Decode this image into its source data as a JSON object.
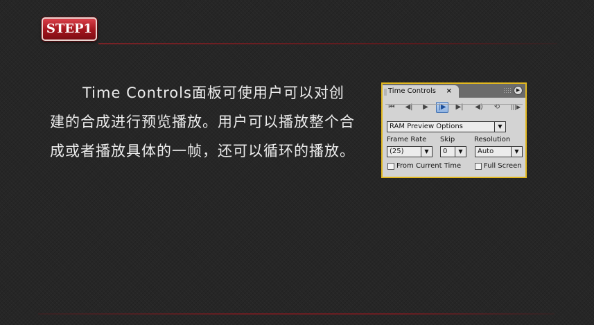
{
  "step_badge": "STEP1",
  "description": "Time Controls面板可使用户可以对创建的合成进行预览播放。用户可以播放整个合成或者播放具体的一帧，还可以循环的播放。",
  "panel": {
    "tab_title": "Time Controls",
    "close_glyph": "×",
    "menu_glyph": "▶",
    "transport": [
      {
        "name": "first-frame",
        "glyph": "⏮"
      },
      {
        "name": "previous-frame",
        "glyph": "◀|"
      },
      {
        "name": "play-pause",
        "glyph": "▶"
      },
      {
        "name": "ram-preview",
        "glyph": "|▶"
      },
      {
        "name": "last-frame",
        "glyph": "▶|"
      },
      {
        "name": "mute-audio",
        "glyph": "◀)"
      },
      {
        "name": "loop",
        "glyph": "⟲"
      },
      {
        "name": "ram-preview-alt",
        "glyph": "|||▶"
      }
    ],
    "preview_options": "RAM Preview Options",
    "frame_rate_label": "Frame Rate",
    "frame_rate_value": "(25)",
    "skip_label": "Skip",
    "skip_value": "0",
    "resolution_label": "Resolution",
    "resolution_value": "Auto",
    "from_current_time": "From Current Time",
    "full_screen": "Full Screen",
    "dropdown_arrow": "▼"
  }
}
